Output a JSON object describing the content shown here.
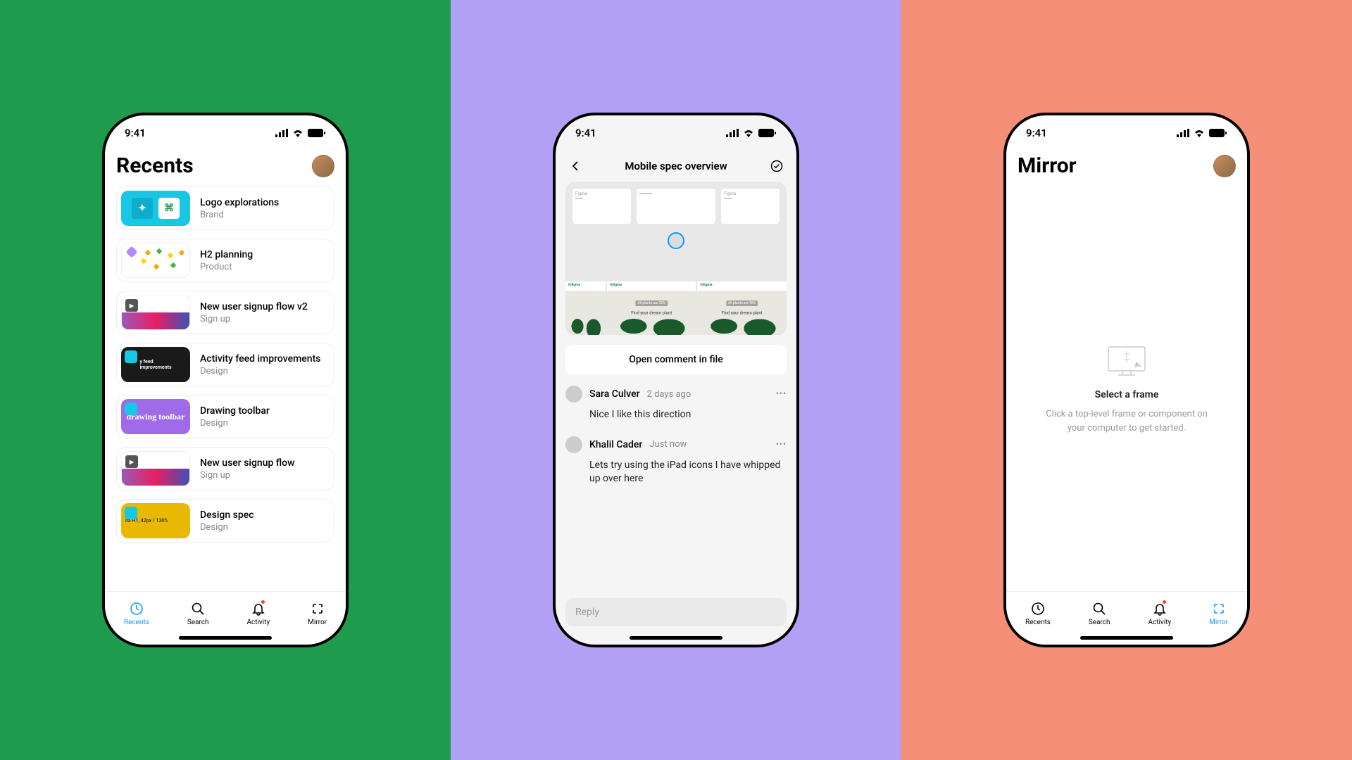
{
  "status": {
    "time": "9:41"
  },
  "tabs": {
    "recents": "Recents",
    "search": "Search",
    "activity": "Activity",
    "mirror": "Mirror"
  },
  "phone1": {
    "title": "Recents",
    "files": [
      {
        "name": "Logo explorations",
        "sub": "Brand"
      },
      {
        "name": "H2 planning",
        "sub": "Product"
      },
      {
        "name": "New user signup flow v2",
        "sub": "Sign up"
      },
      {
        "name": "Activity feed improvements",
        "sub": "Design"
      },
      {
        "name": "Drawing toolbar",
        "sub": "Design"
      },
      {
        "name": "New user signup flow",
        "sub": "Sign up"
      },
      {
        "name": "Design spec",
        "sub": "Design"
      }
    ]
  },
  "phone2": {
    "title": "Mobile spec overview",
    "open_btn": "Open comment in file",
    "preview": {
      "brand": "foligma",
      "promo": "All plants are 30%",
      "hero": "Find your dream plant"
    },
    "comments": [
      {
        "name": "Sara Culver",
        "time": "2 days ago",
        "body": "Nice I like this direction"
      },
      {
        "name": "Khalil Cader",
        "time": "Just now",
        "body": "Lets try using the iPad icons I have whipped up over here"
      }
    ],
    "reply_placeholder": "Reply"
  },
  "phone3": {
    "title": "Mirror",
    "empty_title": "Select a frame",
    "empty_sub": "Click a top-level frame or component on your computer to get started."
  }
}
